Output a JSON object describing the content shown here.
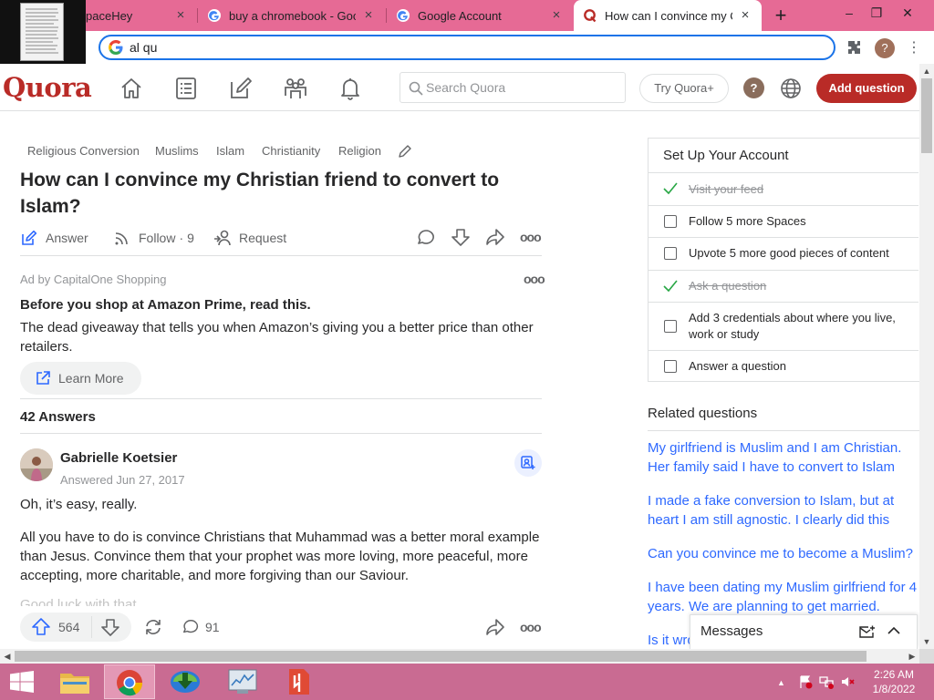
{
  "browser": {
    "tabs": [
      {
        "title": "paceHey",
        "favicon": "myspace-favicon"
      },
      {
        "title": "buy a chromebook - Goog",
        "favicon": "google-favicon"
      },
      {
        "title": "Google Account",
        "favicon": "google-favicon"
      },
      {
        "title": "How can I convince my Ch",
        "favicon": "quora-favicon",
        "active": true
      }
    ],
    "new_tab": "+",
    "close": "×",
    "omnibox_value": "al qu",
    "profile_initial": "?",
    "window_controls": {
      "minimize": "–",
      "restore": "❐",
      "close": "✕"
    }
  },
  "quora": {
    "logo": "Quora",
    "nav_icons": [
      "home-icon",
      "following-icon",
      "answer-icon",
      "spaces-icon",
      "notifications-icon"
    ],
    "search_placeholder": "Search Quora",
    "try_label": "Try Quora+",
    "help_label": "?",
    "add_question_label": "Add question"
  },
  "question": {
    "topics": [
      "Religious Conversion",
      "Muslims",
      "Islam",
      "Christianity",
      "Religion"
    ],
    "title": "How can I convince my Christian friend to convert to Islam?",
    "actions": {
      "answer": "Answer",
      "follow": "Follow",
      "follow_sep": "·",
      "follow_count": "9",
      "request": "Request"
    }
  },
  "ad": {
    "by": "Ad by CapitalOne Shopping",
    "title": "Before you shop at Amazon Prime, read this.",
    "text": "The dead giveaway that tells you when Amazon’s giving you a better price than other retailers.",
    "cta": "Learn More",
    "more": "ooo"
  },
  "answers": {
    "count_label": "42 Answers",
    "first": {
      "author": "Gabrielle Koetsier",
      "answered": "Answered Jun 27, 2017",
      "paragraphs": [
        "Oh, it’s easy, really.",
        "All you have to do is convince Christians that Muhammad was a better moral example than Jesus. Convince them that your prophet was more loving, more peaceful, more accepting, more charitable, and more forgiving than our Saviour."
      ],
      "cutoff": "Good luck with that.",
      "upvotes": "564",
      "comments": "91",
      "more": "ooo"
    }
  },
  "sidebar": {
    "setup_title": "Set Up Your Account",
    "tasks": [
      {
        "label": "Visit your feed",
        "done": true
      },
      {
        "label": "Follow 5 more Spaces",
        "done": false
      },
      {
        "label": "Upvote 5 more good pieces of content",
        "done": false
      },
      {
        "label": "Ask a question",
        "done": true
      },
      {
        "label": "Add 3 credentials about where you live, work or study",
        "done": false
      },
      {
        "label": "Answer a question",
        "done": false
      }
    ],
    "related_title": "Related questions",
    "related": [
      "My girlfriend is Muslim and I am Christian. Her family said I have to convert to Islam to…",
      "I made a fake conversion to Islam, but at heart I am still agnostic. I clearly did this to…",
      "Can you convince me to become a Muslim?",
      "I have been dating my Muslim girlfriend for 4 years. We are planning to get married. Why…",
      "Is it wro"
    ],
    "messages_label": "Messages"
  },
  "taskbar": {
    "apps": [
      "start-button",
      "file-explorer",
      "chrome",
      "internet-download-manager",
      "task-manager",
      "pdf-app"
    ],
    "time": "2:26 AM",
    "date": "1/8/2022"
  },
  "colors": {
    "quora_red": "#b92b27",
    "link_blue": "#2e69ff",
    "tab_strip": "#e66a95",
    "taskbar": "#c96b92"
  }
}
